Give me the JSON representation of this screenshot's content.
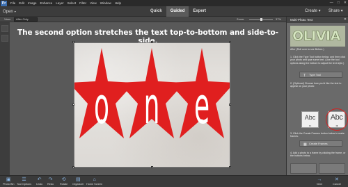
{
  "menu": {
    "logo": "Pr",
    "items": [
      "File",
      "Edit",
      "Image",
      "Enhance",
      "Layer",
      "Select",
      "Filter",
      "View",
      "Window",
      "Help"
    ]
  },
  "window_controls": [
    "—",
    "□",
    "✕"
  ],
  "modebar": {
    "open_label": "Open",
    "modes": [
      "Quick",
      "Guided",
      "Expert"
    ],
    "active_mode": "Guided",
    "create_label": "Create",
    "share_label": "Share"
  },
  "options": {
    "view_label": "View:",
    "view_value": "After Only",
    "zoom_label": "Zoom:",
    "zoom_value": "37%",
    "zoom_level": 0.37
  },
  "canvas": {
    "headline": "The second option stretches the text top-to-bottom and side-to-side.",
    "letters": [
      "o",
      "n",
      "e"
    ],
    "star_color": "#e01f1f"
  },
  "panel": {
    "title": "Multi-Photo Text",
    "after_label": "After (Roll over to see Before.)",
    "step1": "1. Click the Type Tool button below, and then click your photo and type some text. (Use the tool options along the bottom to adjust the text style.)",
    "type_tool_label": "Type Tool",
    "step2": "2. (Optional) Choose how you'd like the text to appear on your photo:",
    "option_fit": "Fit",
    "option_fill": "Fill",
    "step3": "3. Click the Create Frames button below to make frames.",
    "create_frames_label": "Create Frames",
    "step4": "4. Add a photo to a frame by clicking the frame, or the buttons below."
  },
  "bottom": {
    "left_items": [
      "Photo Bin",
      "Tool Options",
      "Undo",
      "Redo",
      "Rotate",
      "Organizer",
      "Home Screen"
    ],
    "next_label": "Next",
    "cancel_label": "Cancel"
  },
  "colors": {
    "accent_circle": "#d62020",
    "active_mode_bg": "#5b5b5b"
  }
}
